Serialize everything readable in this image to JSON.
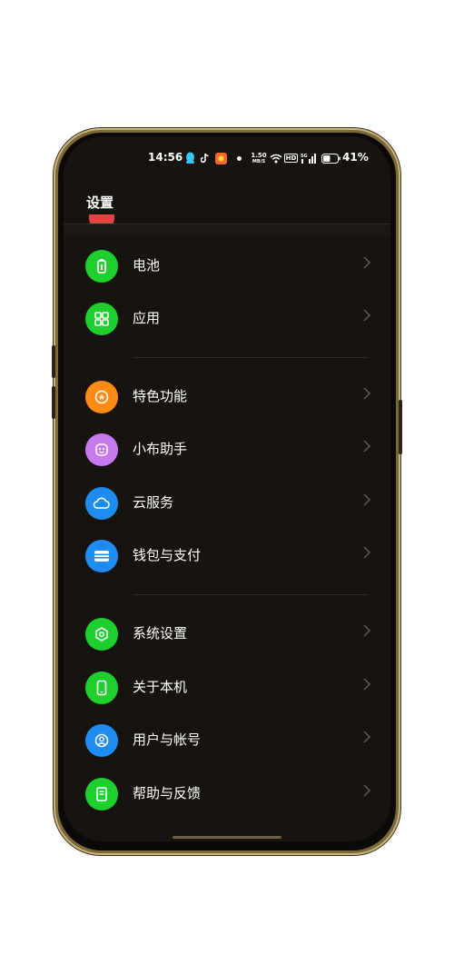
{
  "status_bar": {
    "time": "14:56",
    "net_speed_top": "1.50",
    "net_speed_unit": "MB/S",
    "hd_label": "HD",
    "battery_percent": "41%"
  },
  "header": {
    "title": "设置"
  },
  "groups": [
    {
      "items": [
        {
          "label": "电池",
          "icon": "battery-icon",
          "color": "#1fcf2e"
        },
        {
          "label": "应用",
          "icon": "apps-grid-icon",
          "color": "#1fcf2e"
        }
      ]
    },
    {
      "items": [
        {
          "label": "特色功能",
          "icon": "star-badge-icon",
          "color": "#ff8a14"
        },
        {
          "label": "小布助手",
          "icon": "assistant-icon",
          "color": "#c57af0"
        },
        {
          "label": "云服务",
          "icon": "cloud-icon",
          "color": "#1e8cf0"
        },
        {
          "label": "钱包与支付",
          "icon": "wallet-icon",
          "color": "#1e8cf0"
        }
      ]
    },
    {
      "items": [
        {
          "label": "系统设置",
          "icon": "hexagon-settings-icon",
          "color": "#1fcf2e"
        },
        {
          "label": "关于本机",
          "icon": "phone-icon",
          "color": "#1fcf2e"
        },
        {
          "label": "用户与帐号",
          "icon": "user-circle-icon",
          "color": "#1e8cf0"
        },
        {
          "label": "帮助与反馈",
          "icon": "help-book-icon",
          "color": "#1fcf2e"
        }
      ]
    }
  ]
}
